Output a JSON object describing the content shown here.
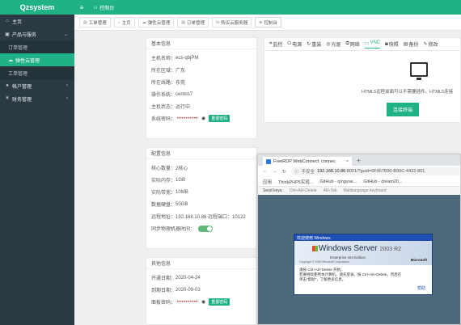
{
  "app": {
    "brand": "Qzsystem"
  },
  "sidebar": {
    "items": [
      {
        "label": "主页",
        "icon": "home-icon"
      },
      {
        "label": "产品与服务",
        "icon": "box-icon"
      },
      {
        "label": "订单管理",
        "icon": ""
      },
      {
        "label": "弹性云管理",
        "icon": "cloud-icon"
      },
      {
        "label": "工单管理",
        "icon": ""
      },
      {
        "label": "帐户管理",
        "icon": "user-icon"
      },
      {
        "label": "财务管理",
        "icon": "money-icon"
      }
    ]
  },
  "topbar": {
    "crumb": "控制台"
  },
  "tabs": [
    {
      "label": "工单管理"
    },
    {
      "label": "主页"
    },
    {
      "label": "弹性云管理"
    },
    {
      "label": "订单管理"
    },
    {
      "label": "购买云服务器"
    },
    {
      "label": "控制台"
    }
  ],
  "basic": {
    "title": "基本信息",
    "rows": [
      {
        "k": "主机名称：",
        "v": "ecs-qbjPM"
      },
      {
        "k": "所在区域：",
        "v": "广东"
      },
      {
        "k": "所在线路：",
        "v": "东莞"
      },
      {
        "k": "操作系统：",
        "v": "centos7"
      },
      {
        "k": "主机状态：",
        "v": "运行中"
      }
    ],
    "password_label": "系统密码：",
    "password_mask": "••••••••••",
    "reset_btn": "重置密码"
  },
  "config": {
    "title": "配置信息",
    "rows": [
      {
        "k": "核心数量：",
        "v": "2核心"
      },
      {
        "k": "实际内存：",
        "v": "1GB"
      },
      {
        "k": "实际带宽：",
        "v": "10MB"
      },
      {
        "k": "数据硬盘：",
        "v": "50GB"
      },
      {
        "k": "远程地址：",
        "v": "192.168.10.86 远程端口：10122"
      }
    ],
    "sync_label": "同步物理机器时间：",
    "sync_on": true
  },
  "other": {
    "title": "其他信息",
    "rows": [
      {
        "k": "开通日期：",
        "v": "2020-04-24"
      },
      {
        "k": "到期日期：",
        "v": "2020-09-03"
      }
    ],
    "panel_pw_label": "面板密码：",
    "panel_pw_mask": "••••••••••",
    "reset_btn": "重置密码"
  },
  "console": {
    "tabs": [
      "监控",
      "电源",
      "重装",
      "光驱",
      "网络",
      "VNC",
      "快照",
      "备份",
      "修改"
    ],
    "active_tab": "VNC",
    "hint": "HTML5远程桌面可以不需要插件。HTML5连接",
    "connect_btn": "连接终端"
  },
  "rdp": {
    "tab_title": "FreeRDP WebConnect: connec",
    "security": "不安全",
    "url_host": "192.168.10.86",
    "url_rest": ":8001/?guid=0F467B90-B90C-4422-801",
    "bookmarks": [
      "应用",
      "ThinkPHP5实现...",
      "GitHub - qingyue...",
      "GitHub - dream20..."
    ],
    "send_keys_label": "Send keys:",
    "keys": [
      "Ctrl+Alt+Delete",
      "Alt+Tab",
      "Multilanguage keyboard"
    ],
    "dialog_title": "欢迎使用 Windows",
    "win_logo": "Windows Server",
    "win_ver": "2003 R2",
    "win_edition": "Enterprise x64 Edition",
    "win_copyright": "Copyright © 2005 Microsoft Corporation",
    "win_ms": "Microsoft",
    "body_line1": "请按 Ctrl+Alt+Delete 开始。",
    "body_line2": "若要继续使用本计算机，请先登录。按 Ctrl+Alt+Delete，然后在",
    "body_line3": "单击\"帮助\"，了解更多信息。",
    "help": "帮助"
  }
}
